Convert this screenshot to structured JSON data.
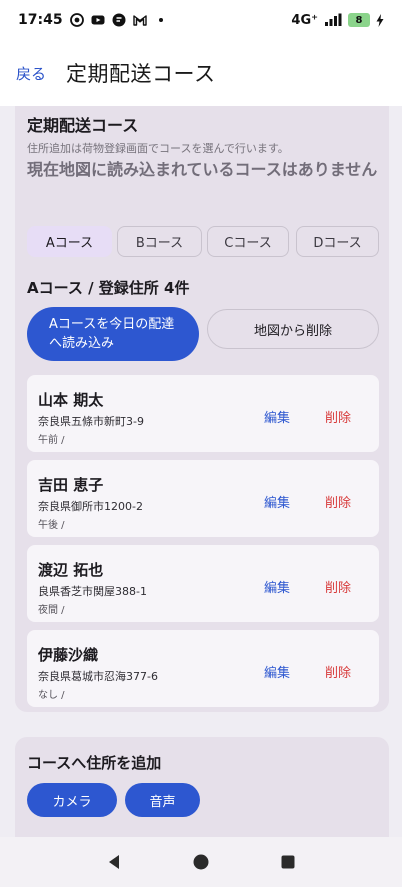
{
  "status": {
    "time": "17:45",
    "notification_icons": [
      "at-icon",
      "youtube-icon",
      "chat-icon",
      "gmail-icon",
      "dot-icon"
    ],
    "network": "4G⁺",
    "battery": "8"
  },
  "header": {
    "back_label": "戻る",
    "title": "定期配送コース"
  },
  "course": {
    "section_title": "定期配送コース",
    "hint": "住所追加は荷物登録画面でコースを選んで行います。",
    "no_course_text": "現在地図に読み込まれているコースはありません",
    "tabs": [
      "Aコース",
      "Bコース",
      "Cコース",
      "Dコース"
    ],
    "active_tab": "Aコース",
    "course_heading": "Aコース / 登録住所 4件",
    "load_button": "Aコースを今日の配達へ読み込み",
    "remove_button": "地図から削除",
    "edit_label": "編集",
    "delete_label": "削除",
    "addresses": [
      {
        "name": "山本 期太",
        "address": "奈良県五條市新町3-9",
        "time": "午前 /"
      },
      {
        "name": "吉田 恵子",
        "address": "奈良県御所市1200-2",
        "time": "午後 /"
      },
      {
        "name": "渡辺 拓也",
        "address": "良県香芝市関屋388-1",
        "time": "夜間 /"
      },
      {
        "name": "伊藤沙織",
        "address": "奈良県葛城市忍海377-6",
        "time": "なし /"
      }
    ]
  },
  "add_section": {
    "title": "コースへ住所を追加",
    "camera_button": "カメラ",
    "voice_button": "音声"
  },
  "colors": {
    "primary": "#2d57d0",
    "danger": "#d83b3b",
    "card": "#e6e0ea",
    "active_tab": "#e7ddf6"
  }
}
